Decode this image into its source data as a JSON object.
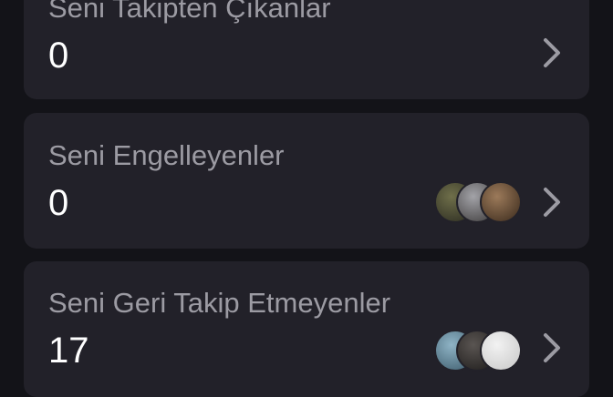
{
  "cards": [
    {
      "label": "Seni Takipten Çıkanlar",
      "count": "0"
    },
    {
      "label": "Seni Engelleyenler",
      "count": "0",
      "avatar_colors": [
        [
          "#6f6f4a",
          "#2a2a20"
        ],
        [
          "#a3a3a8",
          "#3c3a3a"
        ],
        [
          "#9c7a5a",
          "#3a2a1c"
        ]
      ]
    },
    {
      "label": "Seni Geri Takip Etmeyenler",
      "count": "17",
      "avatar_colors": [
        [
          "#8fb4c6",
          "#3c5a6a"
        ],
        [
          "#5a5552",
          "#1d1b1a"
        ],
        [
          "#f2f2f2",
          "#c8c8c8"
        ]
      ]
    }
  ],
  "colors": {
    "background": "#131318",
    "card": "#222129",
    "label": "#9c9ba3",
    "count": "#ffffff",
    "chevron": "#9c9ba3"
  }
}
